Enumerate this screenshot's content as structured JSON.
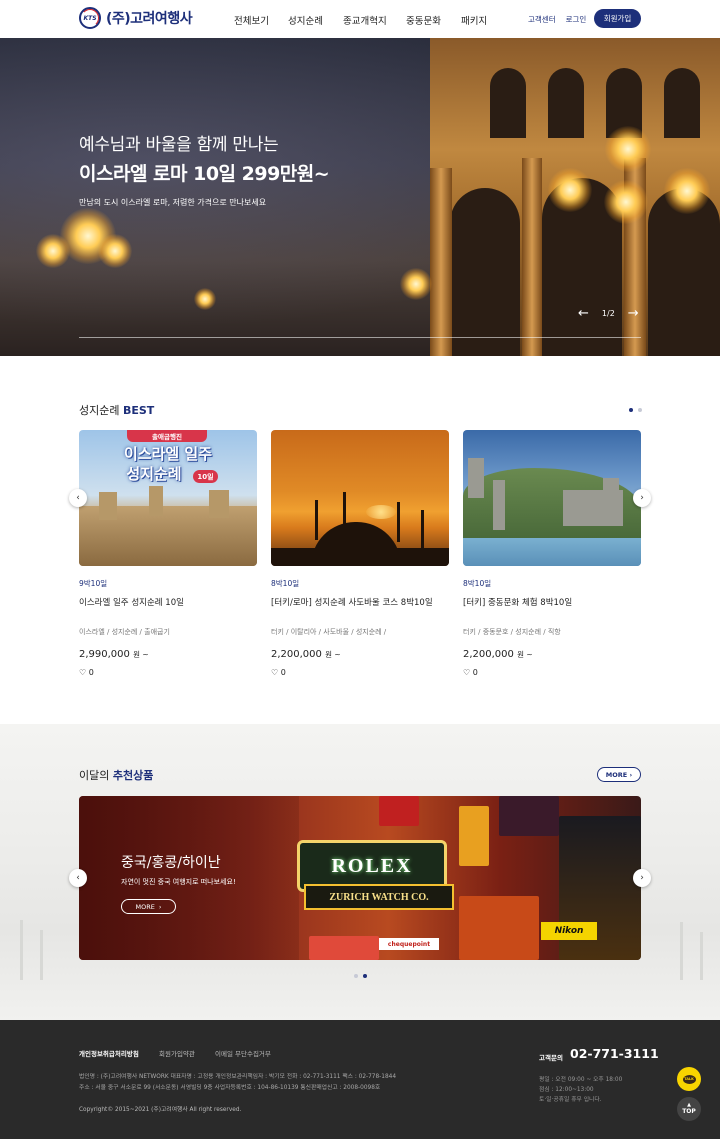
{
  "header": {
    "logo_mark": "KTS",
    "logo_text": "(주)고려여행사",
    "nav": [
      "전체보기",
      "성지순례",
      "종교개혁지",
      "중동문화",
      "패키지"
    ],
    "util": [
      "고객센터",
      "로그인"
    ],
    "join": "회원가입"
  },
  "hero": {
    "title1": "예수님과 바울을 함께 만나는",
    "title2": "이스라엘 로마 10일 299만원~",
    "sub": "만남의 도시 이스라엘 로마, 저렴한 가격으로 만나보세요",
    "prev": "←",
    "page": "1/2",
    "next": "→"
  },
  "best": {
    "title_plain": "성지순례 ",
    "title_strong": "BEST",
    "prev": "‹",
    "next": "›",
    "cards": [
      {
        "banner": "출애굽행진",
        "img_line1": "이스라엘 일주",
        "img_line2": "성지순례",
        "img_badge": "10일",
        "days": "9박10일",
        "name": "이스라엘 일주 성지순례 10일",
        "tags": "이스라엘 / 성지순례 / 출애굽기",
        "price": "2,990,000",
        "unit": "원 ~",
        "likes": "0"
      },
      {
        "days": "8박10일",
        "name": "[터키/로마] 성지순례 사도바울 코스 8박10일",
        "tags": "터키 / 이탈리아 / 사도바울 / 성지순례 /",
        "price": "2,200,000",
        "unit": "원 ~",
        "likes": "0"
      },
      {
        "days": "8박10일",
        "name": "[터키] 중동문화 체험 8박10일",
        "tags": "터키 / 중동문호 / 성지순례 / 직항",
        "price": "2,200,000",
        "unit": "원 ~",
        "likes": "0"
      }
    ]
  },
  "recommend": {
    "title_plain": "이달의 ",
    "title_strong": "추천상품",
    "more": "MORE",
    "more_arrow": "›",
    "prev": "‹",
    "next": "›",
    "banner_title": "중국/홍콩/하이난",
    "banner_sub": "자연이 멋진 중국 여행지로 떠나보세요!",
    "banner_more": "MORE",
    "sign_rolex": "ROLEX",
    "sign_zurich": "ZURICH WATCH CO.",
    "sign_cheque": "chequepoint",
    "sign_nikon": "Nikon"
  },
  "footer": {
    "links": [
      "개인정보취급처리방침",
      "회원가입약관",
      "이메일 무단수집거부"
    ],
    "info1": "법인명 : (주)고려여행사 NETWORK    대표자명 : 고정용    개인정보관리책임자 : 박기모    전화 : 02-771-3111    팩스 : 02-778-1844",
    "info2": "주소 : 서울 중구 서소문로 99 (서소문동) 서영빌딩 9층    사업자등록번호 : 104-86-10139    통신판매업신고 : 2008-0098호",
    "copyright": "Copyright© 2015~2021 (주)고려여행사 All right reserved.",
    "cs_label": "고객문의",
    "cs_phone": "02-771-3111",
    "hours": [
      "평일 : 오전 09:00 ~ 오후 18:00",
      "점심 : 12:00~13:00",
      "토·일·공휴일 휴무 입니다."
    ]
  },
  "floating": {
    "talk": "TALK",
    "top_caret": "▲",
    "top": "TOP"
  },
  "colors": {
    "brand_navy": "#1d2f7a",
    "accent_red": "#d2232a",
    "footer_bg": "#2a2a2a",
    "talk_yellow": "#f8d400"
  }
}
